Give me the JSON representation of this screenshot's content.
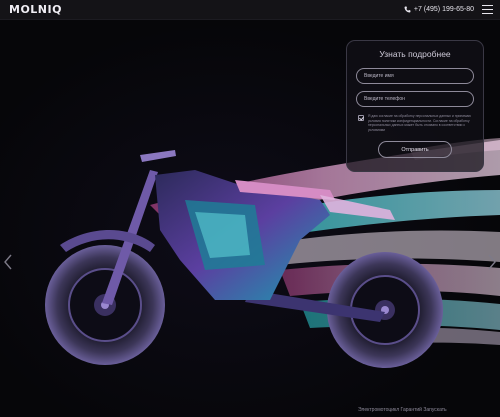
{
  "header": {
    "logo": "MOLNIQ",
    "phone": "+7 (495) 199-65-80"
  },
  "form": {
    "title": "Узнать подробнее",
    "name_placeholder": "Введите имя",
    "phone_placeholder": "Введите телефон",
    "consent_text": "Я даю согласие на обработку персональных данных и принимаю условия политики конфиденциальности. Согласие на обработку персональных данных может быть отозвано в соответствии с условиями",
    "consent_checked": true,
    "submit_label": "Отправить"
  },
  "caption": "Электромотоцикл Гарантий Запускать",
  "colors": {
    "header_bg": "#141317",
    "page_bg": "#060609",
    "accent_magenta": "#c2458f",
    "accent_cyan": "#5fe6e0",
    "accent_violet": "#7a4fd0"
  },
  "icons": {
    "phone": "phone-icon",
    "menu": "hamburger-menu-icon",
    "prev": "chevron-left-icon",
    "next": "chevron-right-icon"
  }
}
